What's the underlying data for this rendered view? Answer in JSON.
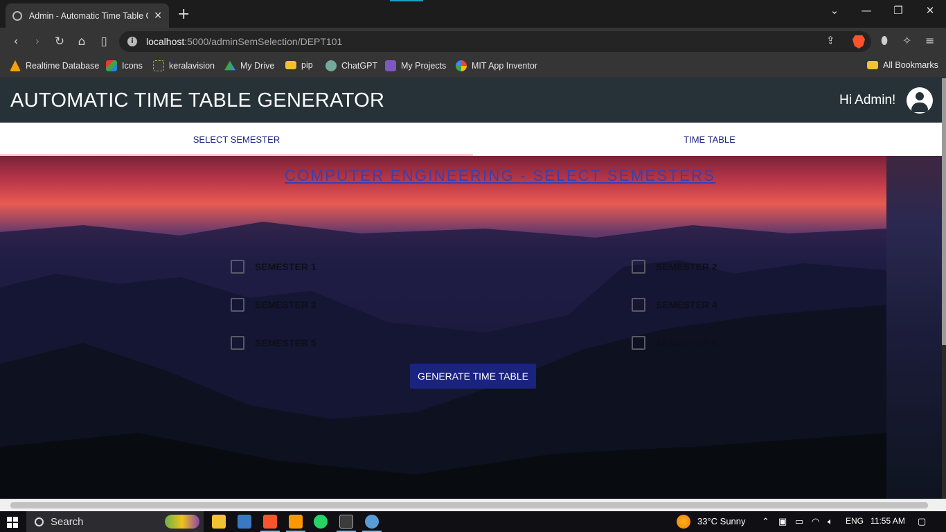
{
  "browser": {
    "tab_title": "Admin - Automatic Time Table G",
    "url_host": "localhost",
    "url_path": ":5000/adminSemSelection/DEPT101",
    "bookmarks": [
      {
        "label": "Realtime Database",
        "icon": "firebase-icon",
        "color": "#ffa000"
      },
      {
        "label": "Icons",
        "icon": "icons-site-icon",
        "color": "#4caf50"
      },
      {
        "label": "keralavision",
        "icon": "keralavision-icon",
        "color": "#8bc34a"
      },
      {
        "label": "My Drive",
        "icon": "google-drive-icon",
        "color": "#1e88e5"
      },
      {
        "label": "pip",
        "icon": "folder-icon",
        "color": "#f2c231"
      },
      {
        "label": "ChatGPT",
        "icon": "chatgpt-icon",
        "color": "#74aa9c"
      },
      {
        "label": "My Projects",
        "icon": "projects-icon",
        "color": "#7e57c2"
      },
      {
        "label": "MIT App Inventor",
        "icon": "google-icon",
        "color": "#ea4335"
      }
    ],
    "all_bookmarks": "All Bookmarks"
  },
  "app": {
    "title": "AUTOMATIC TIME TABLE GENERATOR",
    "greeting": "Hi Admin!",
    "tabs": [
      {
        "label": "SELECT SEMESTER",
        "active": true
      },
      {
        "label": "TIME TABLE",
        "active": false
      }
    ],
    "section_title": "COMPUTER ENGINEERING - SELECT SEMESTERS",
    "semesters": [
      {
        "label": "SEMESTER 1",
        "checked": false
      },
      {
        "label": "SEMESTER 2",
        "checked": false
      },
      {
        "label": "SEMESTER 3",
        "checked": false
      },
      {
        "label": "SEMESTER 4",
        "checked": false
      },
      {
        "label": "SEMESTER 5",
        "checked": false
      },
      {
        "label": "SEMESTER 6",
        "checked": false
      }
    ],
    "generate_button": "GENERATE TIME TABLE",
    "colors": {
      "header": "#263238",
      "accent": "#1a237e",
      "tab_indicator": "#ffcdd2"
    }
  },
  "taskbar": {
    "search_label": "Search",
    "weather": "33°C  Sunny",
    "language": "ENG",
    "time": "11:55 AM"
  }
}
